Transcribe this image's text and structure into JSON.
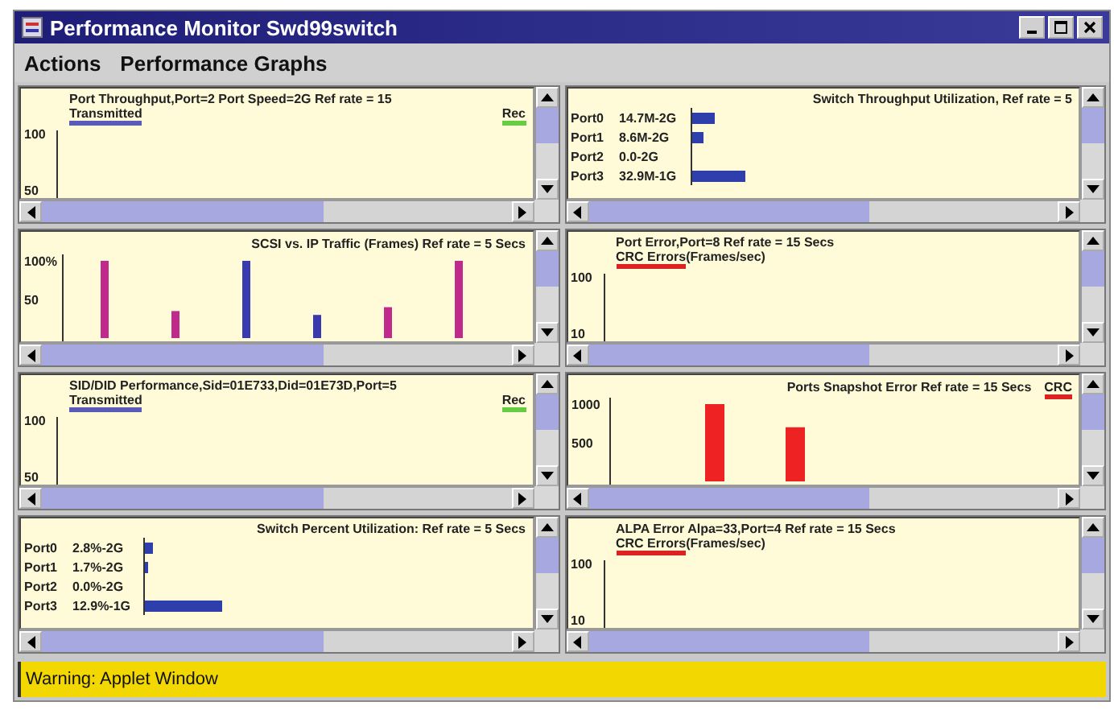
{
  "window": {
    "title": "Performance Monitor Swd99switch"
  },
  "menu": [
    {
      "label": "Actions"
    },
    {
      "label": "Performance Graphs"
    }
  ],
  "panels": [
    {
      "kind": "line",
      "title": "Port Throughput,Port=2 Port Speed=2G Ref rate = 15",
      "legend": [
        {
          "label": "Transmitted",
          "color": "#5a5ab8"
        },
        {
          "label": "Rec",
          "color": "#66cc44"
        }
      ],
      "y_labels": [
        "100",
        "50"
      ]
    },
    {
      "kind": "hbar",
      "title": "Switch Throughput Utilization, Ref rate = 5",
      "rows": [
        {
          "port": "Port0",
          "value": "14.7M-2G",
          "level": 0.06
        },
        {
          "port": "Port1",
          "value": "8.6M-2G",
          "level": 0.03
        },
        {
          "port": "Port2",
          "value": "0.0-2G"
        },
        {
          "port": "Port3",
          "value": "32.9M-1G",
          "level": 0.14
        }
      ]
    },
    {
      "kind": "vbar",
      "title": "SCSI vs. IP Traffic (Frames)  Ref rate = 5 Secs",
      "chart_data": {
        "type": "bar",
        "categories": [
          null,
          null,
          null,
          null,
          null,
          null
        ],
        "stacked": true,
        "ylim": [
          0,
          100
        ],
        "yticks": [
          {
            "value": 100,
            "label": "100%"
          },
          {
            "value": 50,
            "label": "50"
          }
        ],
        "series": [
          {
            "color": "#c02a8c",
            "values": [
              100,
              35,
              null,
              null,
              40,
              100
            ]
          },
          {
            "color": "#3a3ab0",
            "values": [
              null,
              null,
              100,
              30,
              null,
              null
            ]
          }
        ]
      }
    },
    {
      "kind": "line",
      "title": "Port Error,Port=8 Ref rate = 15 Secs",
      "legend": [
        {
          "label": "CRC Errors",
          "unit": "(Frames/sec)",
          "color": "#dd2222"
        }
      ],
      "y_labels": [
        "100",
        "10"
      ]
    },
    {
      "kind": "line",
      "title": "SID/DID Performance,Sid=01E733,Did=01E73D,Port=5",
      "legend": [
        {
          "label": "Transmitted",
          "color": "#5a5ab8"
        },
        {
          "label": "Rec",
          "color": "#66cc44"
        }
      ],
      "y_labels": [
        "100",
        "50"
      ]
    },
    {
      "kind": "vbar",
      "title": "Ports Snapshot Error   Ref rate = 15 Secs",
      "legend": [
        {
          "label": "CRC",
          "color": "#dd2222"
        }
      ],
      "chart_data": {
        "type": "bar",
        "categories": [
          null,
          null
        ],
        "ylim": [
          0,
          1000
        ],
        "yticks": [
          {
            "value": 1000,
            "label": "1000"
          },
          {
            "value": 500,
            "label": "500"
          }
        ],
        "series": [
          {
            "color": "#ee2222",
            "values": [
              1000,
              700
            ]
          }
        ]
      }
    },
    {
      "kind": "hbar",
      "title": "Switch Percent Utilization: Ref rate = 5 Secs",
      "rows": [
        {
          "port": "Port0",
          "value": "2.8%-2G",
          "level": 0.02
        },
        {
          "port": "Port1",
          "value": "1.7%-2G",
          "level": 0.01
        },
        {
          "port": "Port2",
          "value": "0.0%-2G"
        },
        {
          "port": "Port3",
          "value": "12.9%-1G",
          "level": 0.2
        }
      ]
    },
    {
      "kind": "line",
      "title": "ALPA Error Alpa=33,Port=4 Ref rate = 15 Secs",
      "legend": [
        {
          "label": "CRC Errors",
          "unit": "(Frames/sec)",
          "color": "#dd2222"
        }
      ],
      "y_labels": [
        "100",
        "10"
      ]
    }
  ],
  "status_bar": "Warning: Applet Window"
}
